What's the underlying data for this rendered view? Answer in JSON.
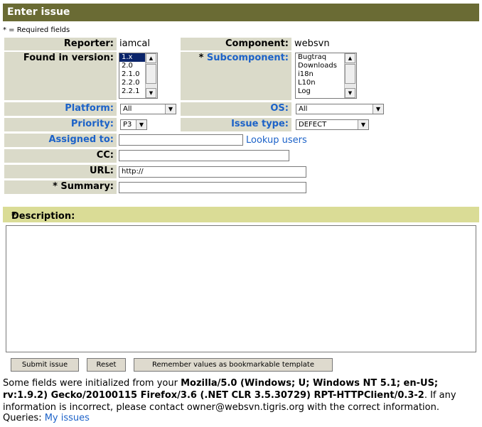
{
  "header": {
    "title": "Enter issue"
  },
  "required_note": "* = Required fields",
  "form": {
    "reporter_label": "Reporter:",
    "reporter_value": "iamcal",
    "component_label": "Component:",
    "component_value": "websvn",
    "found_in_label": "Found in version:",
    "found_in_options": [
      "1.x",
      "2.0",
      "2.1.0",
      "2.2.0",
      "2.2.1"
    ],
    "required_star": "*",
    "subcomponent_label": "Subcomponent:",
    "subcomponent_options": [
      "Bugtraq",
      "Downloads",
      "i18n",
      "L10n",
      "Log"
    ],
    "platform_label": "Platform:",
    "platform_value": "All",
    "os_label": "OS:",
    "os_value": "All",
    "priority_label": "Priority:",
    "priority_value": "P3",
    "issue_type_label": "Issue type:",
    "issue_type_value": "DEFECT",
    "assigned_label": "Assigned to:",
    "assigned_value": "",
    "lookup_users": "Lookup users",
    "cc_label": "CC:",
    "cc_value": "",
    "url_label": "URL:",
    "url_value": "http://",
    "summary_label": "Summary:",
    "summary_value": ""
  },
  "description": {
    "label": "Description:",
    "value": ""
  },
  "buttons": {
    "submit": "Submit issue",
    "reset": "Reset",
    "remember": "Remember values as bookmarkable template"
  },
  "footer": {
    "text1": "Some fields were initialized from your ",
    "ua": "Mozilla/5.0 (Windows; U; Windows NT 5.1; en-US; rv:1.9.2) Gecko/20100115 Firefox/3.6 (.NET CLR 3.5.30729) RPT-HTTPClient/0.3-2",
    "text2": ". If any information is incorrect, please contact owner@websvn.tigris.org with the correct information.",
    "queries_label": "Queries:",
    "my_issues": "My issues"
  },
  "colors": {
    "titlebar": "#6a6b34",
    "label_bg": "#dadac9",
    "desc_bar": "#dadc96",
    "link": "#1c62c8"
  }
}
